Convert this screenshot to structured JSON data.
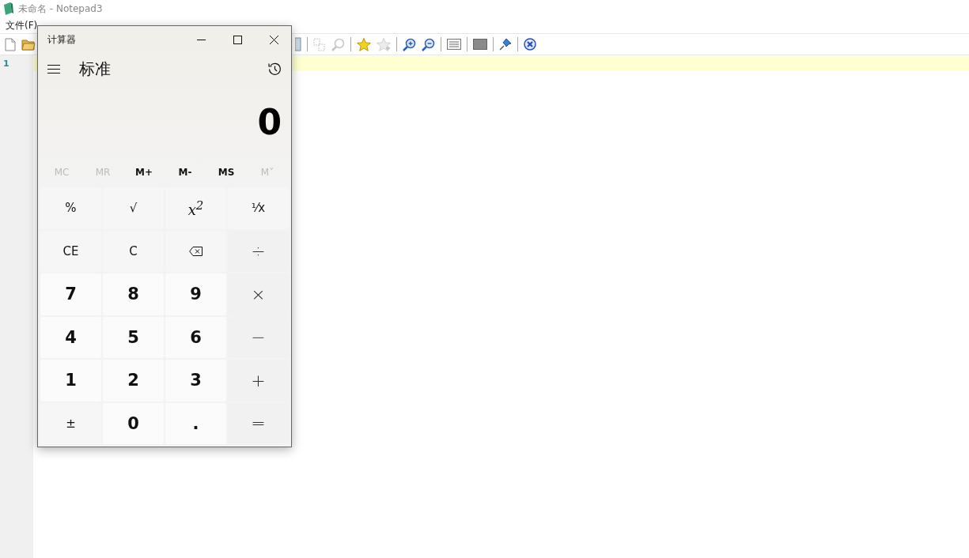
{
  "editor_window": {
    "title": "未命名 - Notepad3",
    "menu": [
      "文件(F)"
    ],
    "line_numbers": [
      "1"
    ]
  },
  "calculator": {
    "title": "计算器",
    "mode": "标准",
    "display": "0",
    "memory": [
      {
        "label": "MC",
        "disabled": true
      },
      {
        "label": "MR",
        "disabled": true
      },
      {
        "label": "M+",
        "disabled": false
      },
      {
        "label": "M-",
        "disabled": false
      },
      {
        "label": "MS",
        "disabled": false
      },
      {
        "label": "M˅",
        "disabled": true
      }
    ],
    "keys": [
      {
        "kind": "function",
        "label": "%"
      },
      {
        "kind": "function",
        "label": "√"
      },
      {
        "kind": "function",
        "label": "x$^{2}$"
      },
      {
        "kind": "function",
        "label": "¹⁄x"
      },
      {
        "kind": "function",
        "label": "CE"
      },
      {
        "kind": "function",
        "label": "C"
      },
      {
        "kind": "backspace"
      },
      {
        "kind": "operator",
        "label": "÷"
      },
      {
        "kind": "digit",
        "label": "7"
      },
      {
        "kind": "digit",
        "label": "8"
      },
      {
        "kind": "digit",
        "label": "9"
      },
      {
        "kind": "operator",
        "label": "×"
      },
      {
        "kind": "digit",
        "label": "4"
      },
      {
        "kind": "digit",
        "label": "5"
      },
      {
        "kind": "digit",
        "label": "6"
      },
      {
        "kind": "operator",
        "label": "−"
      },
      {
        "kind": "digit",
        "label": "1"
      },
      {
        "kind": "digit",
        "label": "2"
      },
      {
        "kind": "digit",
        "label": "3"
      },
      {
        "kind": "operator",
        "label": "+"
      },
      {
        "kind": "function",
        "label": "±"
      },
      {
        "kind": "digit",
        "label": "0"
      },
      {
        "kind": "digit",
        "label": "."
      },
      {
        "kind": "operator",
        "label": "="
      }
    ]
  }
}
